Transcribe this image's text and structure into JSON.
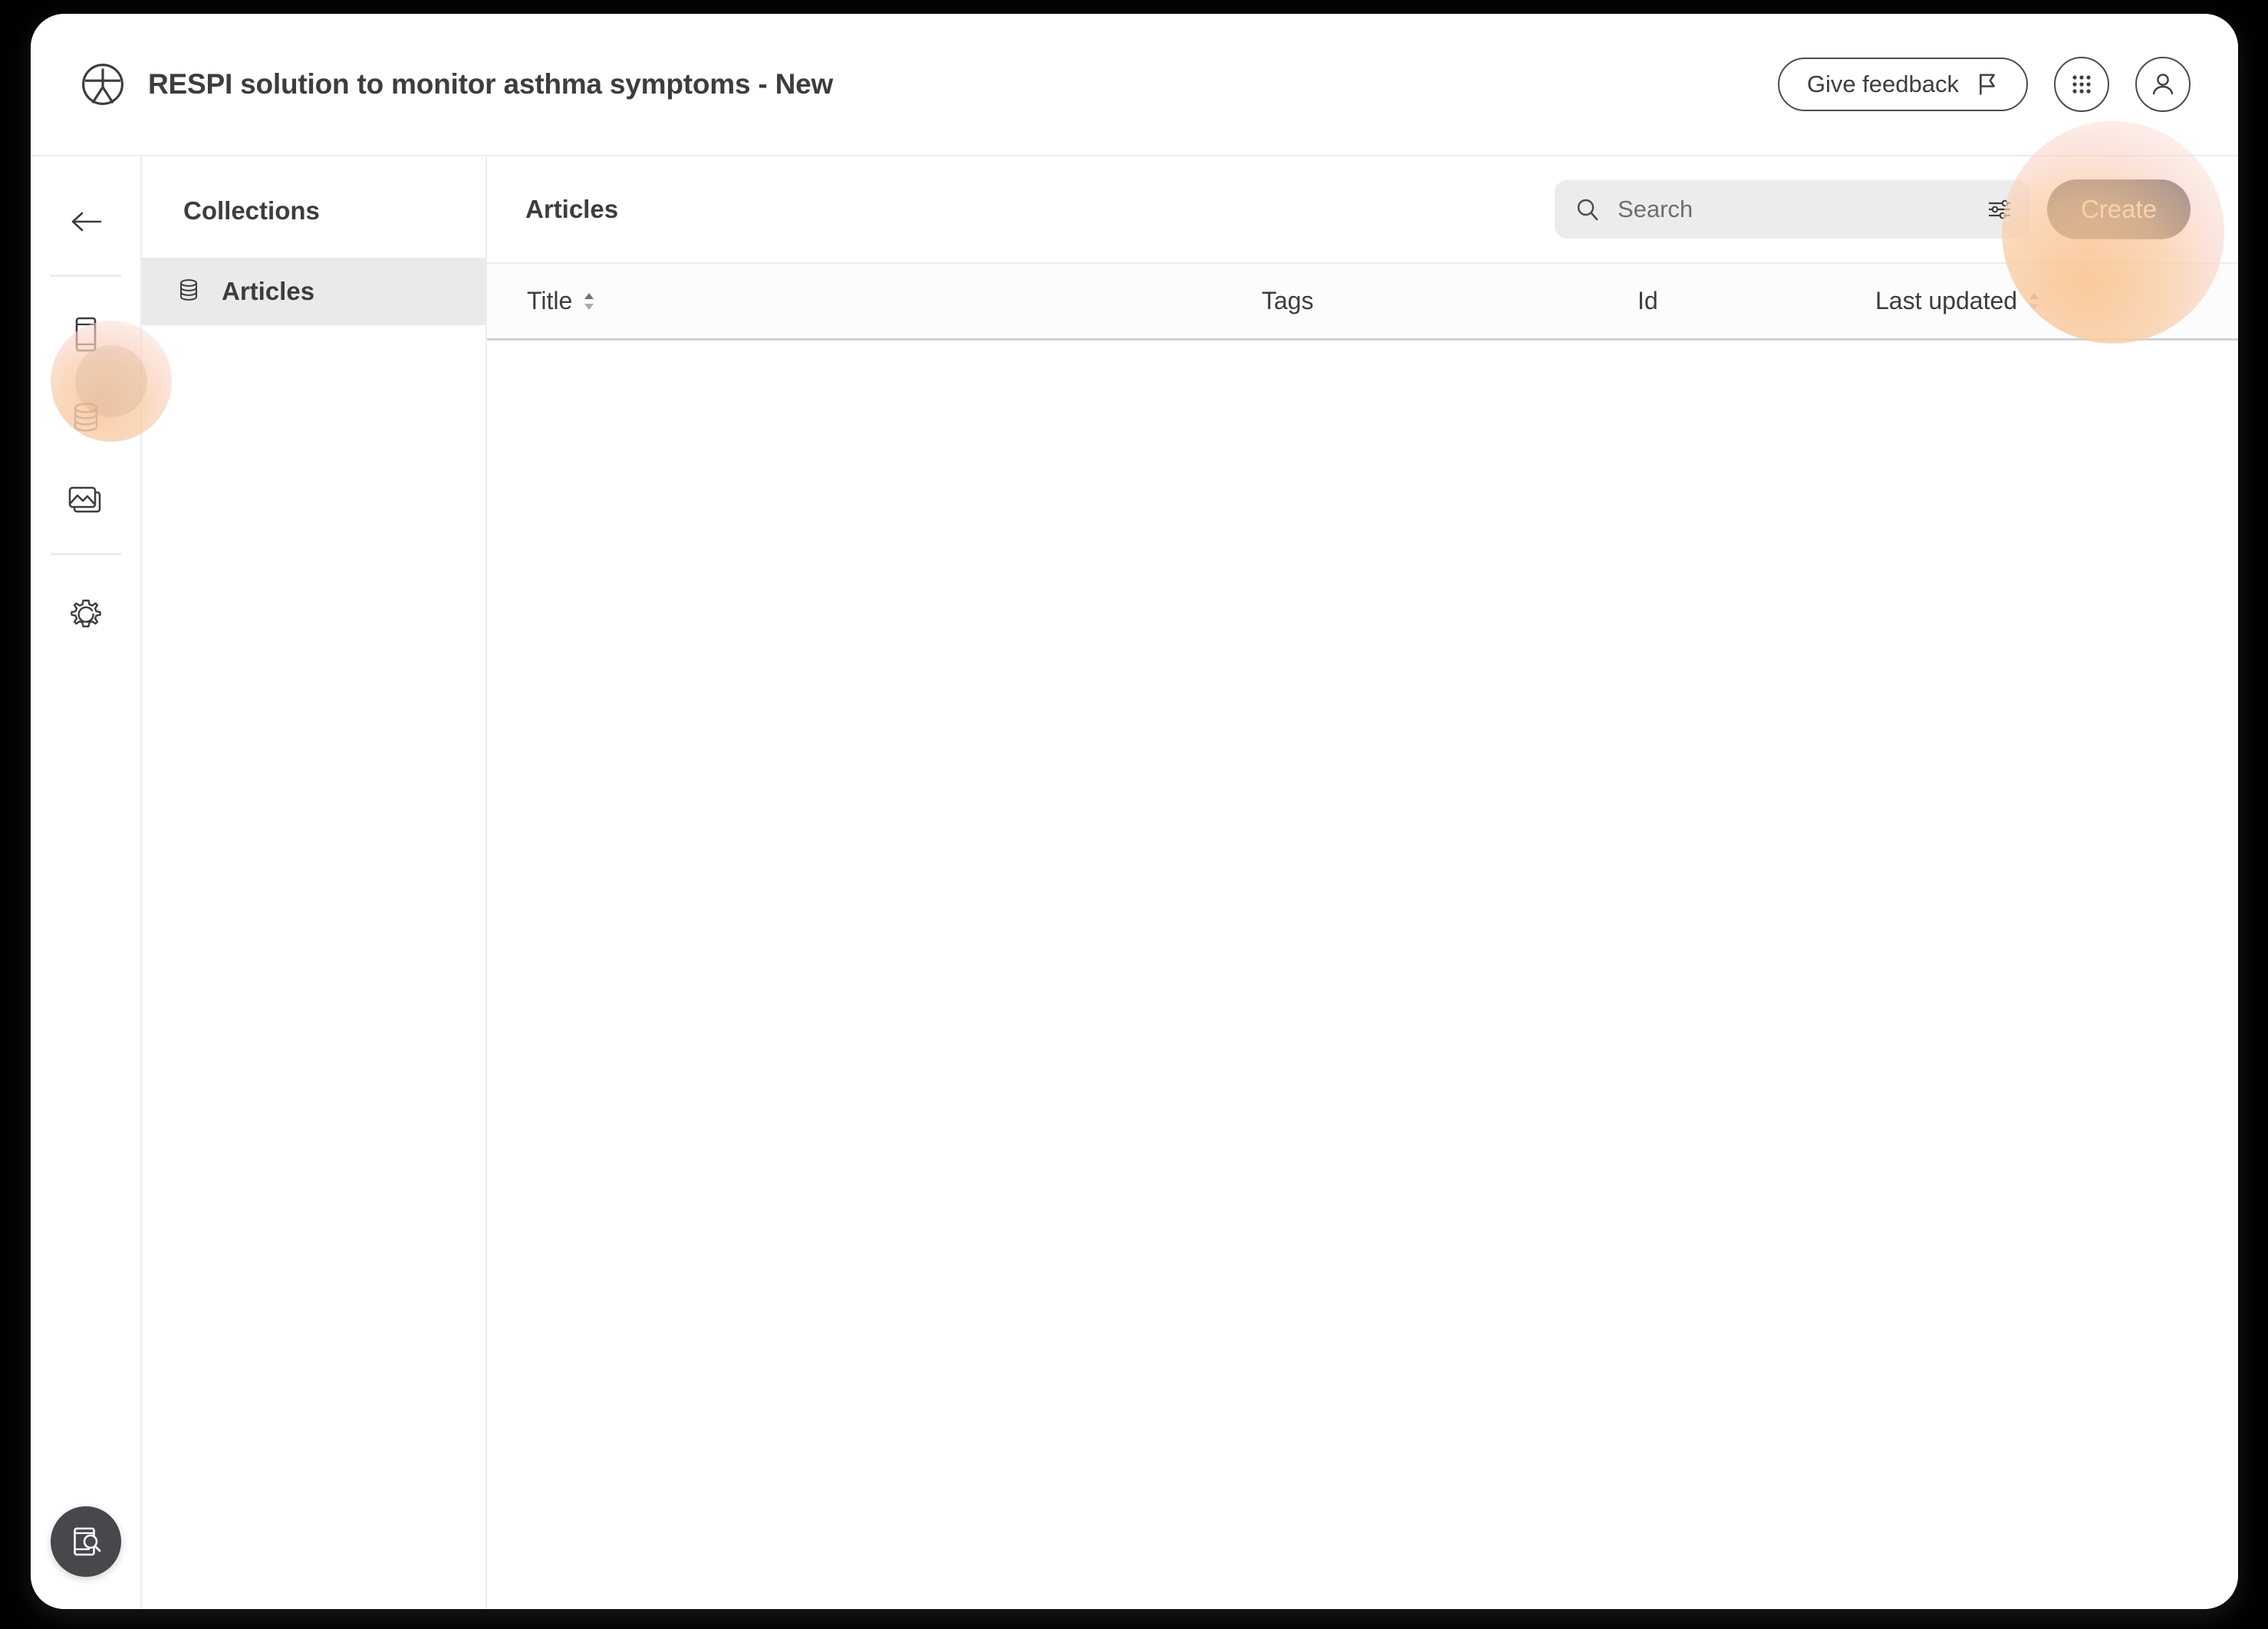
{
  "window": {
    "background_color": "#000000",
    "surface_color": "#ffffff"
  },
  "topbar": {
    "logo_icon": "circle-person-logo-icon",
    "title": "RESPI solution to monitor asthma symptoms - New",
    "feedback_button": {
      "label": "Give feedback",
      "icon": "flag-icon"
    },
    "apps_button": {
      "icon": "grid-dots-icon"
    },
    "account_button": {
      "icon": "user-avatar-icon"
    }
  },
  "left_rail": {
    "back_button": {
      "icon": "arrow-left-icon"
    },
    "items": [
      {
        "icon": "mobile-screen-icon",
        "name": "screens",
        "selected": false
      },
      {
        "icon": "database-icon",
        "name": "collections",
        "selected": true
      },
      {
        "icon": "images-stack-icon",
        "name": "media",
        "selected": false
      },
      {
        "icon": "gear-icon",
        "name": "settings",
        "selected": false
      }
    ],
    "preview_button": {
      "icon": "mobile-preview-search-icon"
    }
  },
  "collections_panel": {
    "title": "Collections",
    "items": [
      {
        "label": "Articles",
        "icon": "database-icon",
        "selected": true
      }
    ]
  },
  "main": {
    "heading": "Articles",
    "search": {
      "placeholder": "Search",
      "value": "",
      "icon": "search-icon",
      "filter_icon": "sliders-filter-icon"
    },
    "create_button": {
      "label": "Create",
      "background_color": "#3a3634",
      "text_color": "#fbdcc8"
    },
    "table": {
      "columns": [
        {
          "label": "Title",
          "sortable": true
        },
        {
          "label": "Tags",
          "sortable": false
        },
        {
          "label": "Id",
          "sortable": false
        },
        {
          "label": "Last updated",
          "sortable": true
        }
      ],
      "rows": []
    }
  },
  "highlights": {
    "accent_color": "#fac594",
    "targets": [
      "create-button",
      "sidebar-item-collections"
    ]
  }
}
